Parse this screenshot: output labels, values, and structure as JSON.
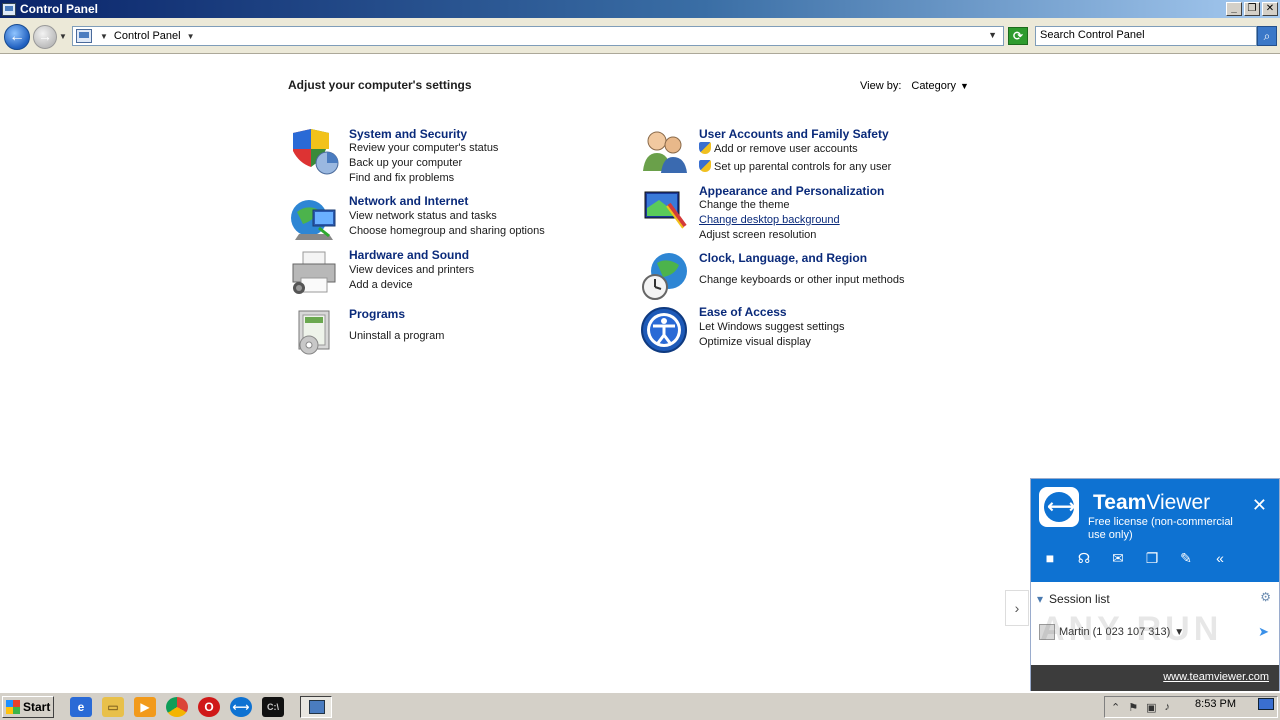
{
  "window": {
    "title": "Control Panel",
    "btn_min": "_",
    "btn_max": "❐",
    "btn_close": "✕"
  },
  "address": {
    "crumb": "Control Panel",
    "search_placeholder": "Search Control Panel"
  },
  "page": {
    "title": "Adjust your computer's settings",
    "view_by_label": "View by:",
    "view_by_value": "Category"
  },
  "categories_left": [
    {
      "title": "System and Security",
      "links": [
        "Review your computer's status",
        "Back up your computer",
        "Find and fix problems"
      ]
    },
    {
      "title": "Network and Internet",
      "links": [
        "View network status and tasks",
        "Choose homegroup and sharing options"
      ]
    },
    {
      "title": "Hardware and Sound",
      "links": [
        "View devices and printers",
        "Add a device"
      ]
    },
    {
      "title": "Programs",
      "links": [
        "Uninstall a program"
      ]
    }
  ],
  "categories_right": [
    {
      "title": "User Accounts and Family Safety",
      "links": [
        "Add or remove user accounts",
        "Set up parental controls for any user"
      ]
    },
    {
      "title": "Appearance and Personalization",
      "links": [
        "Change the theme",
        "Change desktop background",
        "Adjust screen resolution"
      ]
    },
    {
      "title": "Clock, Language, and Region",
      "links": [
        "Change keyboards or other input methods"
      ]
    },
    {
      "title": "Ease of Access",
      "links": [
        "Let Windows suggest settings",
        "Optimize visual display"
      ]
    }
  ],
  "teamviewer": {
    "brand_bold": "Team",
    "brand_light": "Viewer",
    "license": "Free license (non-commercial use only)",
    "session_list": "Session list",
    "partner": "Martin (1 023 107 313)",
    "link": "www.teamviewer.com",
    "watermark": "ANY RUN"
  },
  "taskbar": {
    "start": "Start",
    "clock": "8:53 PM"
  }
}
